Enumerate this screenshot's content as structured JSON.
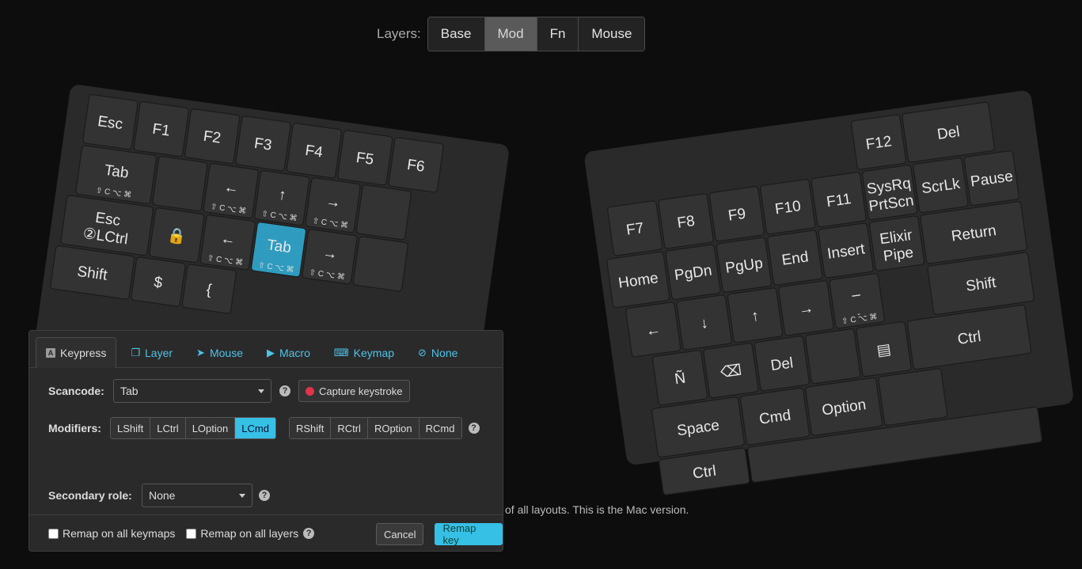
{
  "layers": {
    "label": "Layers:",
    "items": [
      "Base",
      "Mod",
      "Fn",
      "Mouse"
    ],
    "active": "Mod"
  },
  "left_keys": [
    {
      "label": "Esc"
    },
    {
      "label": "F1"
    },
    {
      "label": "F2"
    },
    {
      "label": "F3"
    },
    {
      "label": "F4"
    },
    {
      "label": "F5"
    },
    {
      "label": "F6"
    },
    {
      "label": "Tab",
      "mods": "⇧ C ⌥ ⌘"
    },
    {
      "label": ""
    },
    {
      "label": "←",
      "mods": "⇧ C ⌥ ⌘"
    },
    {
      "label": "↑",
      "mods": "⇧ C ⌥ ⌘"
    },
    {
      "label": "→",
      "mods": "⇧ C ⌥ ⌘"
    },
    {
      "label": ""
    },
    {
      "label": "Esc",
      "sub": "②LCtrl"
    },
    {
      "label": "🔒"
    },
    {
      "label": "←",
      "mods": "⇧ C ⌥ ⌘"
    },
    {
      "label": "Tab",
      "mods": "⇧ C ⌥ ⌘"
    },
    {
      "label": "→",
      "mods": "⇧ C ⌥ ⌘"
    },
    {
      "label": ""
    },
    {
      "label": "Shift"
    },
    {
      "label": "$"
    },
    {
      "label": "{"
    }
  ],
  "right_keys": [
    {
      "label": "F12"
    },
    {
      "label": "Del"
    },
    {
      "label": "F7"
    },
    {
      "label": "F8"
    },
    {
      "label": "F9"
    },
    {
      "label": "F10"
    },
    {
      "label": "F11"
    },
    {
      "label": "SysRq",
      "sub": "PrtScn"
    },
    {
      "label": "ScrLk"
    },
    {
      "label": "Pause"
    },
    {
      "label": "Home"
    },
    {
      "label": "PgDn"
    },
    {
      "label": "PgUp"
    },
    {
      "label": "End"
    },
    {
      "label": "Insert"
    },
    {
      "label": "Elixir",
      "sub": "Pipe"
    },
    {
      "label": "Return"
    },
    {
      "label": "←"
    },
    {
      "label": "↓"
    },
    {
      "label": "↑"
    },
    {
      "label": "→"
    },
    {
      "label": "–",
      "sub": "-",
      "mods": "⇧ C ⌥ ⌘"
    },
    {
      "label": "Shift"
    },
    {
      "label": "Ñ"
    },
    {
      "label": "⌫"
    },
    {
      "label": "Del"
    },
    {
      "label": ""
    },
    {
      "label": "▤"
    },
    {
      "label": "Ctrl"
    },
    {
      "label": "Space"
    },
    {
      "label": "Cmd"
    },
    {
      "label": "Option"
    },
    {
      "label": ""
    },
    {
      "label": "Ctrl"
    },
    {
      "label": ""
    }
  ],
  "footer_note": "of all layouts. This is the Mac version.",
  "dialog": {
    "tabs": [
      "Keypress",
      "Layer",
      "Mouse",
      "Macro",
      "Keymap",
      "None"
    ],
    "active_tab": "Keypress",
    "scancode_label": "Scancode:",
    "scancode_value": "Tab",
    "capture_label": "Capture keystroke",
    "modifiers_label": "Modifiers:",
    "left_mods": [
      "LShift",
      "LCtrl",
      "LOption",
      "LCmd"
    ],
    "right_mods": [
      "RShift",
      "RCtrl",
      "ROption",
      "RCmd"
    ],
    "active_mod": "LCmd",
    "secondary_label": "Secondary role:",
    "secondary_value": "None",
    "remap_all_keymaps": "Remap on all keymaps",
    "remap_all_layers": "Remap on all layers",
    "cancel": "Cancel",
    "remap": "Remap key",
    "help": "?"
  },
  "colors": {
    "accent": "#36c0e6",
    "selected_key": "#2f9cbf",
    "key": "#333333",
    "board": "#2a2a2a"
  }
}
